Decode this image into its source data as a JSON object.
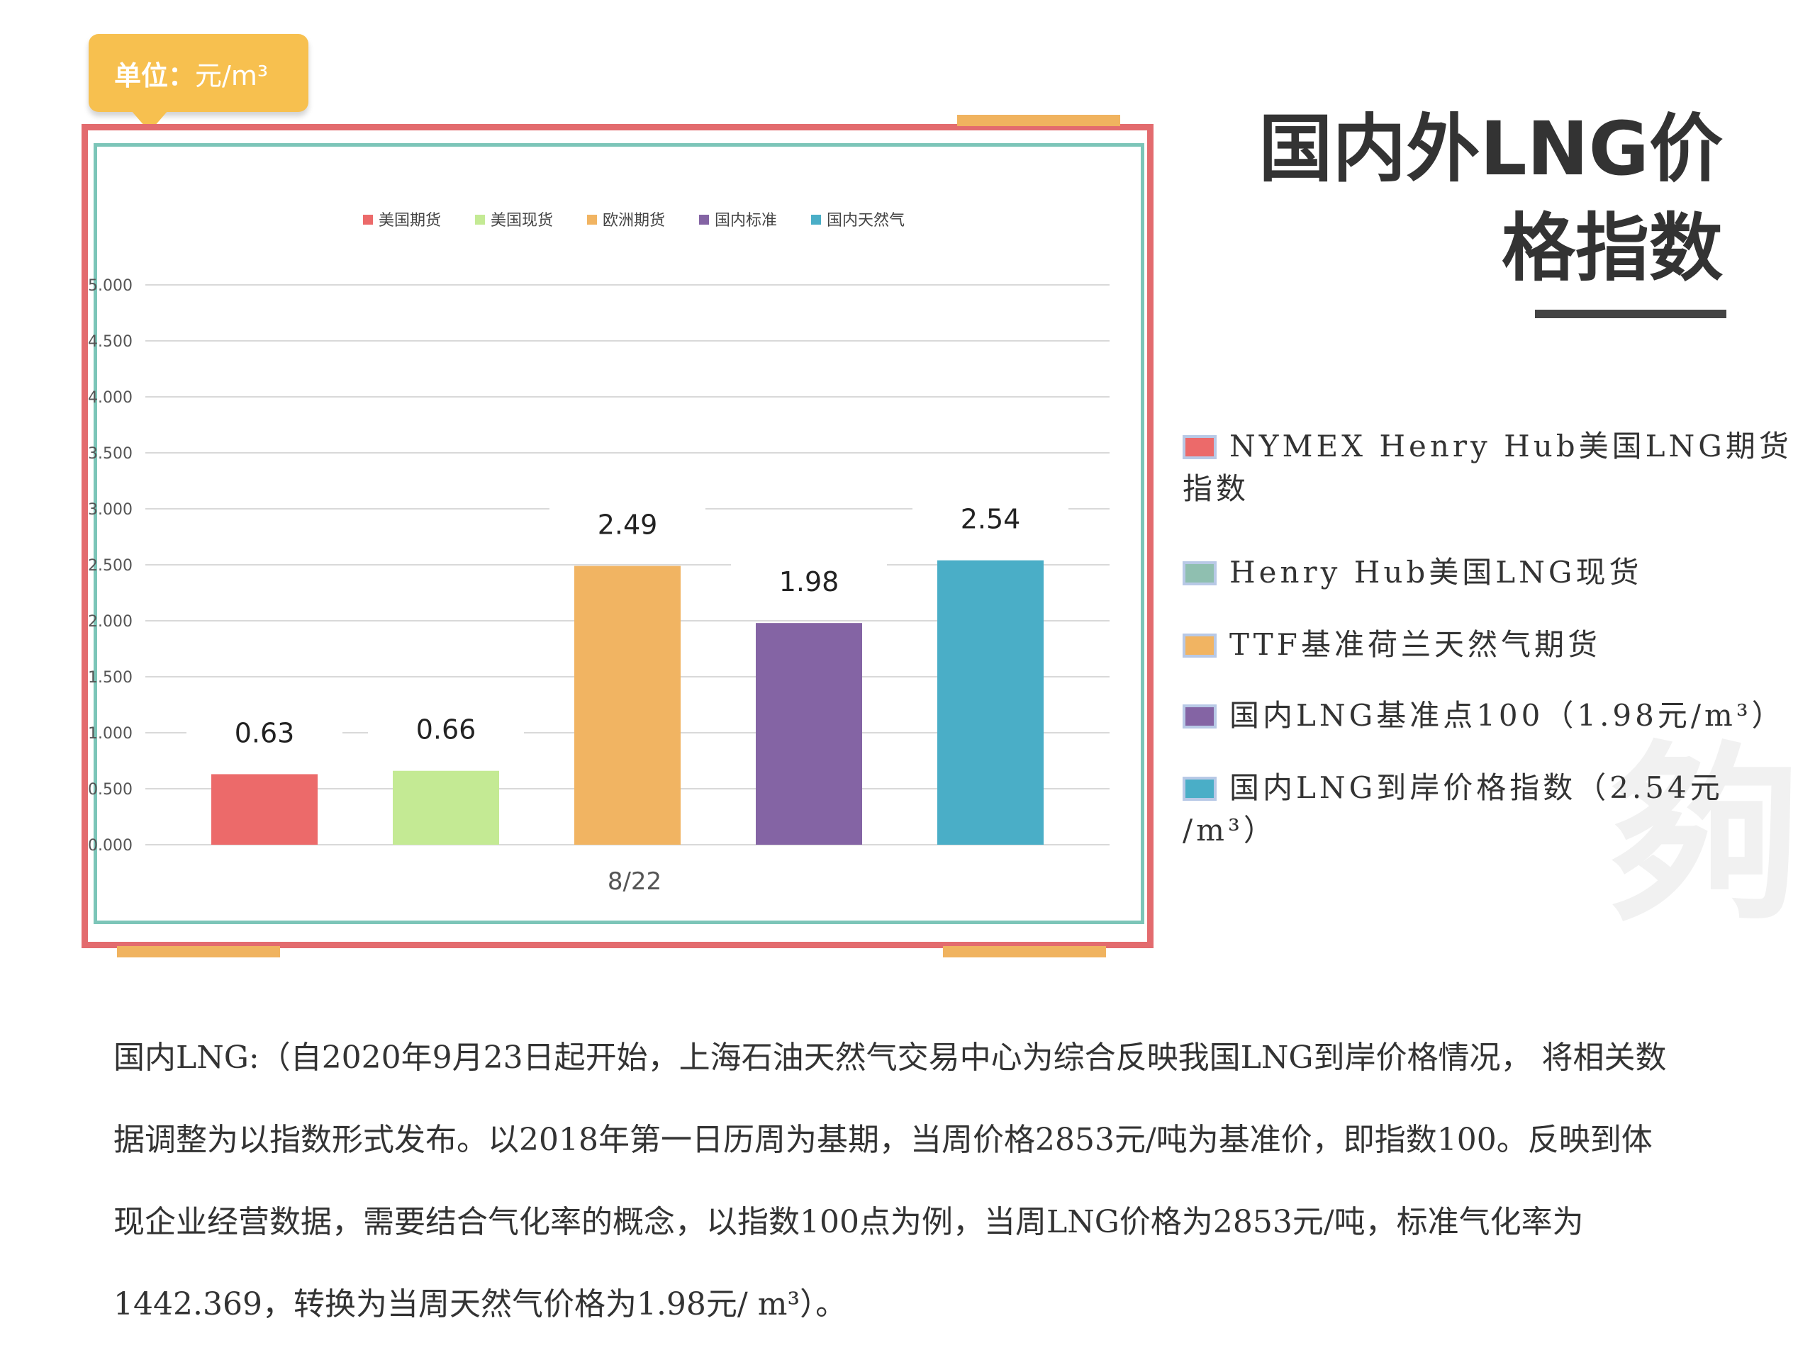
{
  "unit_tag": {
    "label": "单位：",
    "value": "元/m³"
  },
  "title": {
    "line1": "国内外LNG价",
    "line2": "格指数"
  },
  "chart_data": {
    "type": "bar",
    "categories": [
      "8/22"
    ],
    "legend": [
      "美国期货",
      "美国现货",
      "欧洲期货",
      "国内标准",
      "国内天然气"
    ],
    "series": [
      {
        "name": "美国期货",
        "values": [
          0.63
        ],
        "label": "0.63",
        "color": "#ec6a6a"
      },
      {
        "name": "美国现货",
        "values": [
          0.66
        ],
        "label": "0.66",
        "color": "#c4ea94"
      },
      {
        "name": "欧洲期货",
        "values": [
          2.49
        ],
        "label": "2.49",
        "color": "#f1b462"
      },
      {
        "name": "国内标准",
        "values": [
          1.98
        ],
        "label": "1.98",
        "color": "#8464a4"
      },
      {
        "name": "国内天然气",
        "values": [
          2.54
        ],
        "label": "2.54",
        "color": "#4aaec7"
      }
    ],
    "yticks": [
      "0.000",
      "0.500",
      "1.000",
      "1.500",
      "2.000",
      "2.500",
      "3.000",
      "3.500",
      "4.000",
      "4.500",
      "5.000"
    ],
    "ylim": [
      0,
      5
    ],
    "grid": true,
    "legend_position": "top"
  },
  "right_legend": [
    {
      "line1": "NYMEX Henry Hub美国LNG期货",
      "line2": "指数",
      "color": "#ec6a6a"
    },
    {
      "line1": "Henry Hub美国LNG现货",
      "line2": "",
      "color": "#8fbfb0"
    },
    {
      "line1": "TTF基准荷兰天然气期货",
      "line2": "",
      "color": "#f1b462"
    },
    {
      "line1": "国内LNG基准点100（1.98元/m³）",
      "line2": "",
      "color": "#8464a4"
    },
    {
      "line1": "国内LNG到岸价格指数（2.54元",
      "line2": "/m³）",
      "color": "#4aaec7"
    }
  ],
  "watermark": "夠",
  "paragraph": [
    "国内LNG:（自2020年9月23日起开始，上海石油天然气交易中心为综合反映我国LNG到岸价格情况， 将相关数",
    "据调整为以指数形式发布。以2018年第一日历周为基期，当周价格2853元/吨为基准价，即指数100。反映到体",
    "现企业经营数据，需要结合气化率的概念，以指数100点为例，当周LNG价格为2853元/吨，标准气化率为",
    "1442.369，转换为当周天然气价格为1.98元/ m³）。"
  ]
}
